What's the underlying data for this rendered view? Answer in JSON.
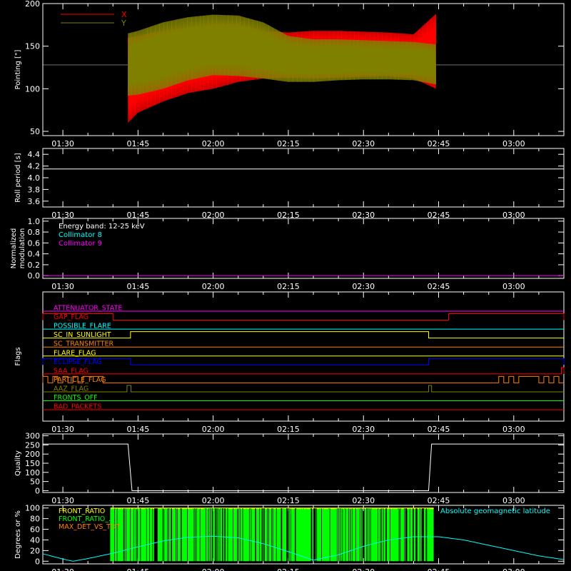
{
  "colors": {
    "background": "#000000",
    "axis": "#ffffff",
    "x_series": "#ff0000",
    "y_series": "#808000",
    "roll": "#ffffff",
    "coll8": "#00ffff",
    "coll9": "#ff00ff",
    "front_ratio": "#ffff00",
    "front_ratio_2": "#00ff00",
    "max_det": "#ff8000",
    "geomag": "#00ffff"
  },
  "time_axis": {
    "tick_labels": [
      "01:30",
      "01:45",
      "02:00",
      "02:15",
      "02:30",
      "02:45",
      "03:00"
    ],
    "tick_minutes": [
      0,
      15,
      30,
      45,
      60,
      75,
      90
    ],
    "range_minutes": [
      -4,
      100
    ]
  },
  "chart_data": [
    {
      "id": "pointing",
      "type": "line",
      "ylabel": "Pointing [\"]",
      "ylim": [
        45,
        200
      ],
      "yticks": [
        50,
        100,
        150,
        200
      ],
      "legend": [
        {
          "name": "X",
          "color": "#ff0000"
        },
        {
          "name": "Y",
          "color": "#808000"
        }
      ],
      "reference_line": 128,
      "data_span_minutes": [
        13,
        74.5
      ],
      "x_envelope": {
        "minutes": [
          13,
          15,
          20,
          25,
          30,
          35,
          40,
          45,
          50,
          55,
          60,
          65,
          70,
          74.5
        ],
        "low": [
          60,
          72,
          85,
          95,
          100,
          108,
          112,
          113,
          112,
          113,
          114,
          115,
          112,
          100
        ],
        "high": [
          160,
          162,
          168,
          172,
          176,
          176,
          168,
          166,
          168,
          168,
          167,
          166,
          164,
          188
        ]
      },
      "y_envelope": {
        "minutes": [
          13,
          15,
          20,
          25,
          30,
          35,
          40,
          45,
          50,
          55,
          60,
          65,
          70,
          74.5
        ],
        "low": [
          92,
          93,
          100,
          110,
          116,
          115,
          112,
          108,
          108,
          110,
          111,
          111,
          110,
          105
        ],
        "high": [
          165,
          168,
          178,
          184,
          187,
          186,
          178,
          162,
          158,
          158,
          157,
          156,
          155,
          152
        ]
      }
    },
    {
      "id": "roll",
      "type": "line",
      "ylabel": "Roll period [s]",
      "ylim": [
        3.5,
        4.5
      ],
      "yticks": [
        3.6,
        3.8,
        4.0,
        4.2,
        4.4
      ],
      "ytick_labels": [
        "3.6",
        "3.8",
        "4.0",
        "4.2",
        "4.4"
      ],
      "value": 4.15
    },
    {
      "id": "modulation",
      "type": "line",
      "ylabel": [
        "Normalized",
        "modulation"
      ],
      "ylim": [
        -0.05,
        1.05
      ],
      "yticks": [
        0.0,
        0.2,
        0.4,
        0.6,
        0.8,
        1.0
      ],
      "ytick_labels": [
        "0.0",
        "0.2",
        "0.4",
        "0.6",
        "0.8",
        "1.0"
      ],
      "annotations": [
        {
          "text": "Energy band: 12-25 keV",
          "color": "#ffffff"
        },
        {
          "text": "Collimator 8",
          "color": "#00ffff"
        },
        {
          "text": "Collimator 9",
          "color": "#ff00ff"
        }
      ],
      "value": 0.0
    },
    {
      "id": "flags",
      "type": "line",
      "ylabel": "Flags",
      "flags": [
        {
          "name": "ATTENUATOR_STATE",
          "color": "#ff00ff",
          "high_intervals": []
        },
        {
          "name": "GAP_FLAG",
          "color": "#ff0000",
          "high_intervals": [
            [
              -4,
              10
            ],
            [
              77,
              100
            ]
          ]
        },
        {
          "name": "POSSIBLE_FLARE",
          "color": "#00ffff",
          "high_intervals": []
        },
        {
          "name": "SC_IN_SUNLIGHT",
          "color": "#ffff00",
          "high_intervals": [
            [
              13.5,
              73
            ]
          ]
        },
        {
          "name": "SC_TRANSMITTER",
          "color": "#ff8000",
          "high_intervals": []
        },
        {
          "name": "FLARE_FLAG",
          "color": "#ffff00",
          "high_intervals": []
        },
        {
          "name": "ECLIPSE_FLAG",
          "color": "#0000ff",
          "high_intervals": [
            [
              -4,
              13.5
            ],
            [
              73,
              100
            ]
          ]
        },
        {
          "name": "SAA_FLAG",
          "color": "#ff0000",
          "high_intervals": [
            [
              99.5,
              100
            ]
          ]
        },
        {
          "name": "PARTICLE_FLAG",
          "color": "#ff8000",
          "high_intervals": [
            [
              -4,
              -3
            ],
            [
              -2,
              -1
            ],
            [
              0,
              1
            ],
            [
              2,
              3
            ],
            [
              4,
              8
            ],
            [
              87,
              88
            ],
            [
              89,
              90
            ],
            [
              91,
              95
            ],
            [
              96,
              97
            ],
            [
              98,
              99
            ]
          ]
        },
        {
          "name": "AAZ_FLAG",
          "color": "#808000",
          "high_intervals": [
            [
              12.8,
              13.6
            ],
            [
              73,
              73.6
            ]
          ]
        },
        {
          "name": "FRONTS_OFF",
          "color": "#00ff00",
          "high_intervals": []
        },
        {
          "name": "BAD_PACKETS",
          "color": "#ff0000",
          "high_intervals": []
        }
      ]
    },
    {
      "id": "quality",
      "type": "line",
      "ylabel": "Quality",
      "ylim": [
        -10,
        310
      ],
      "yticks": [
        0,
        50,
        100,
        150,
        200,
        250,
        300
      ],
      "ytick_labels": [
        "0",
        "50",
        "100",
        "150",
        "200",
        "250",
        "300"
      ],
      "segments": [
        {
          "x": [
            -4,
            13
          ],
          "y": [
            255,
            255
          ]
        },
        {
          "x": [
            13,
            13.8
          ],
          "y": [
            255,
            0
          ]
        },
        {
          "x": [
            13.8,
            73
          ],
          "y": [
            0,
            0
          ]
        },
        {
          "x": [
            73,
            73.6
          ],
          "y": [
            0,
            255
          ]
        },
        {
          "x": [
            73.6,
            100
          ],
          "y": [
            255,
            255
          ]
        }
      ]
    },
    {
      "id": "ratios",
      "type": "line",
      "ylabel": "Degrees or %",
      "ylim": [
        -5,
        105
      ],
      "yticks": [
        0,
        20,
        40,
        60,
        80,
        100
      ],
      "ytick_labels": [
        "0",
        "20",
        "40",
        "60",
        "80",
        "100"
      ],
      "legend": [
        {
          "name": "FRONT_RATIO",
          "color": "#ffff00"
        },
        {
          "name": "FRONT_RATIO_...",
          "color": "#00ff00"
        },
        {
          "name": "MAX_DET_VS_TOT",
          "color": "#ff8000"
        }
      ],
      "geomag_label": "Absolute geomagnetic latitude",
      "front_ratio_span_minutes": [
        9.5,
        74
      ],
      "geomag": {
        "minutes": [
          -4,
          0,
          2,
          5,
          10,
          15,
          20,
          25,
          30,
          35,
          40,
          45,
          50,
          55,
          60,
          65,
          70,
          75,
          80,
          85,
          90,
          95,
          100
        ],
        "values": [
          14,
          4,
          0,
          5,
          15,
          27,
          38,
          45,
          47,
          44,
          33,
          18,
          2,
          12,
          28,
          40,
          46,
          46,
          40,
          30,
          20,
          10,
          3
        ]
      }
    }
  ]
}
